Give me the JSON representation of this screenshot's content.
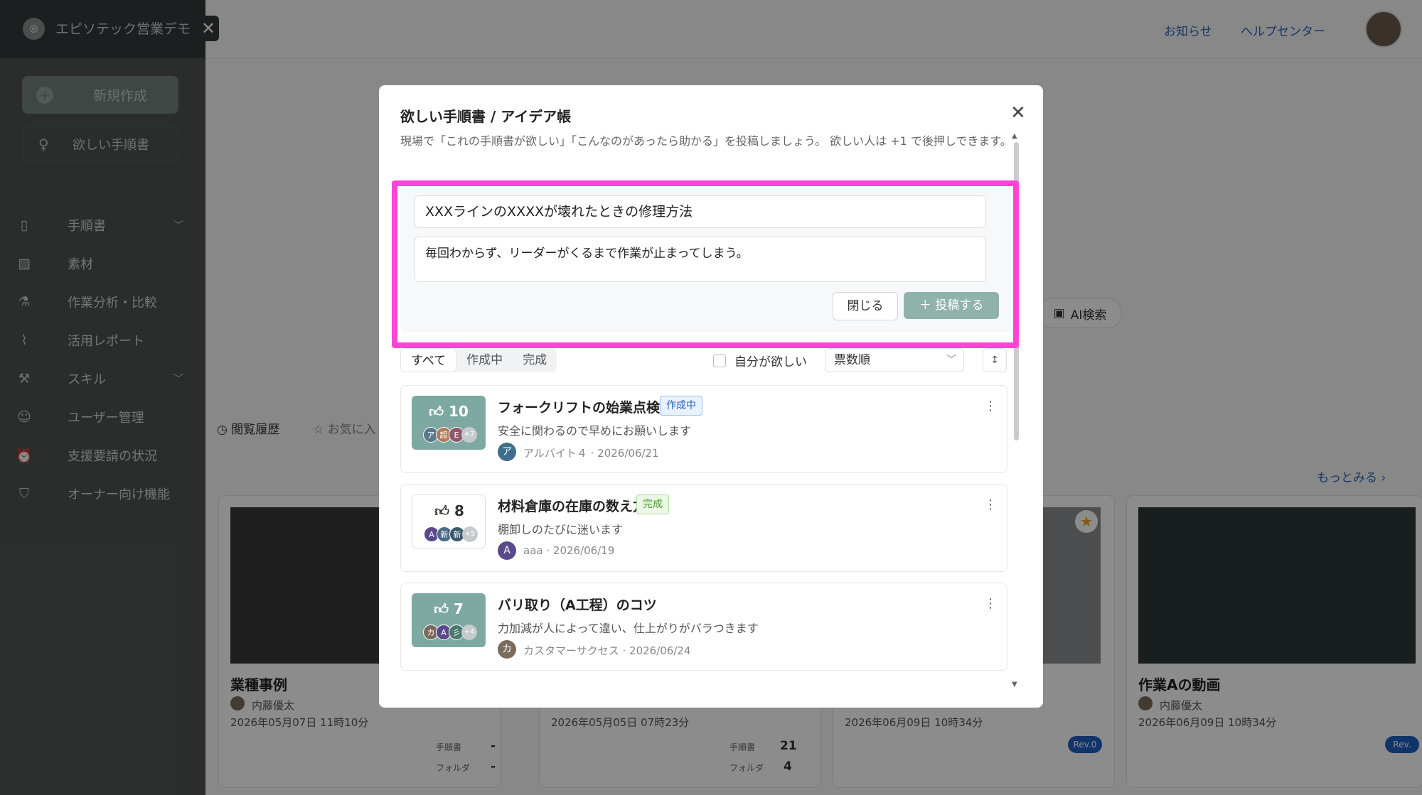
{
  "sidebar": {
    "workspace_name": "エピソテック営業デモ",
    "new_button": "新規作成",
    "wish_button": "欲しい手順書",
    "nav": [
      {
        "label": "手順書",
        "icon": "document-icon",
        "chevron": true
      },
      {
        "label": "素材",
        "icon": "image-icon",
        "chevron": false
      },
      {
        "label": "作業分析・比較",
        "icon": "flask-icon",
        "chevron": false
      },
      {
        "label": "活用レポート",
        "icon": "chart-line-icon",
        "chevron": false
      },
      {
        "label": "スキル",
        "icon": "wrench-icon",
        "chevron": true
      },
      {
        "label": "ユーザー管理",
        "icon": "user-icon",
        "chevron": false
      },
      {
        "label": "支援要請の状況",
        "icon": "alarm-icon",
        "chevron": false
      },
      {
        "label": "オーナー向け機能",
        "icon": "shield-icon",
        "chevron": false
      }
    ]
  },
  "topbar": {
    "news": "お知らせ",
    "help": "ヘルプセンター"
  },
  "background": {
    "ai_search": "AI検索",
    "tab_history": "閲覧履歴",
    "tab_favorites": "お気に入",
    "more": "もっとみる",
    "cards": [
      {
        "title": "業種事例",
        "author": "内藤優太",
        "date": "2026年05月07日 11時10分",
        "manual_label": "手順書",
        "manual_count": "-",
        "folder_label": "フォルダ",
        "folder_count": "-"
      },
      {
        "title": "",
        "author": "",
        "date": "2026年05月05日 07時23分",
        "manual_label": "手順書",
        "manual_count": "21",
        "folder_label": "フォルダ",
        "folder_count": "4"
      },
      {
        "title": "",
        "author": "",
        "date": "2026年06月09日 10時34分",
        "rev": "Rev.0"
      },
      {
        "title": "作業Aの動画",
        "author": "内藤優太",
        "date": "2026年06月09日 10時34分",
        "rev": "Rev."
      }
    ]
  },
  "modal": {
    "title": "欲しい手順書 / アイデア帳",
    "description": "現場で「これの手順書が欲しい」「こんなのがあったら助かる」を投稿しましょう。 欲しい人は +1 で後押しできます。",
    "compose": {
      "title_value": "XXXラインのXXXXが壊れたときの修理方法",
      "body_value": "毎回わからず、リーダーがくるまで作業が止まってしまう。",
      "close_button": "閉じる",
      "post_button": "投稿する"
    },
    "filters": {
      "tabs": [
        "すべて",
        "作成中",
        "完成"
      ],
      "active_tab": "すべて",
      "mine_label": "自分が欲しい",
      "sort_value": "票数順"
    },
    "items": [
      {
        "votes": "10",
        "voted": true,
        "voter_initials": [
          "ア",
          "超",
          "E"
        ],
        "more": "+7",
        "title": "フォークリフトの始業点検",
        "status": "作成中",
        "status_kind": "prog",
        "description": "安全に関わるので早めにお願いします",
        "author_initial": "ア",
        "author": "アルバイト４",
        "date": "· 2026/06/21"
      },
      {
        "votes": "8",
        "voted": false,
        "voter_initials": [
          "A",
          "新",
          "新"
        ],
        "more": "+5",
        "title": "材料倉庫の在庫の数え方",
        "status": "完成",
        "status_kind": "done",
        "description": "棚卸しのたびに迷います",
        "author_initial": "A",
        "author": "aaa",
        "date": "· 2026/06/19"
      },
      {
        "votes": "7",
        "voted": true,
        "voter_initials": [
          "カ",
          "A",
          "彡"
        ],
        "more": "+4",
        "title": "バリ取り（A工程）のコツ",
        "status": "",
        "status_kind": "",
        "description": "力加減が人によって違い、仕上がりがバラつきます",
        "author_initial": "カ",
        "author": "カスタマーサクセス",
        "date": "· 2026/06/24"
      }
    ]
  },
  "colors": {
    "highlight": "#ff44d6",
    "accent": "#7ea8a2",
    "link": "#2c66b8",
    "sidebar": "#4d5351"
  }
}
